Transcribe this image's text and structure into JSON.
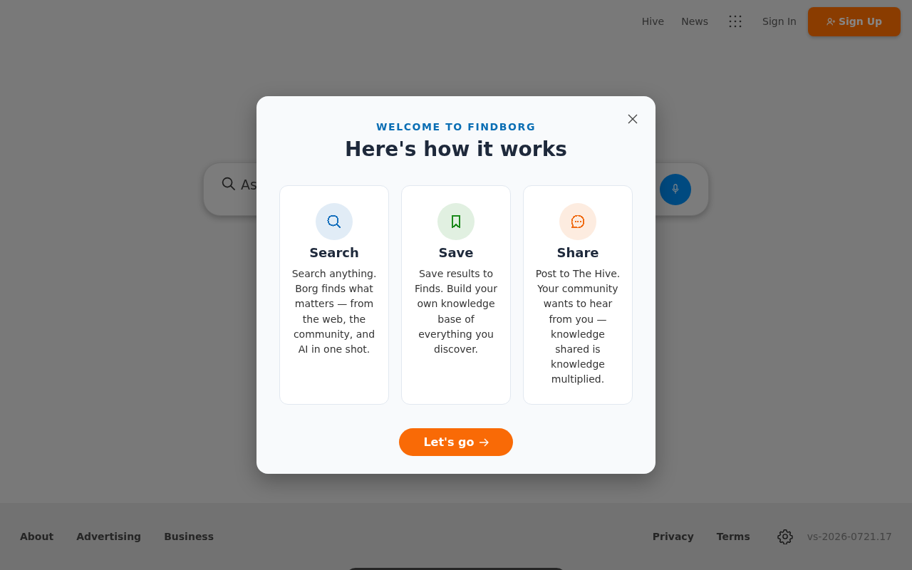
{
  "header": {
    "links": [
      "Hive",
      "News"
    ],
    "sign_in": "Sign In",
    "sign_up": "Sign Up"
  },
  "search": {
    "placeholder": "As"
  },
  "modal": {
    "eyebrow": "WELCOME TO FINDBORG",
    "title": "Here's how it works",
    "cards": [
      {
        "kind": "search",
        "color": "#1670bd",
        "title": "Search",
        "text": "Search anything. Borg finds what matters — from the web, the community, and AI in one shot."
      },
      {
        "kind": "bookmark",
        "color": "#1b8a1b",
        "title": "Save",
        "text": "Save results to Finds. Build your own knowledge base of everything you discover."
      },
      {
        "kind": "chat",
        "color": "#ef6b14",
        "title": "Share",
        "text": "Post to The Hive. Your community wants to hear from you — knowledge shared is knowledge multiplied."
      }
    ],
    "button": "Let's go"
  },
  "footer": {
    "left_links": [
      "About",
      "Advertising",
      "Business"
    ],
    "right_links": [
      "Privacy",
      "Terms"
    ],
    "version": "vs-2026-0721.17"
  }
}
